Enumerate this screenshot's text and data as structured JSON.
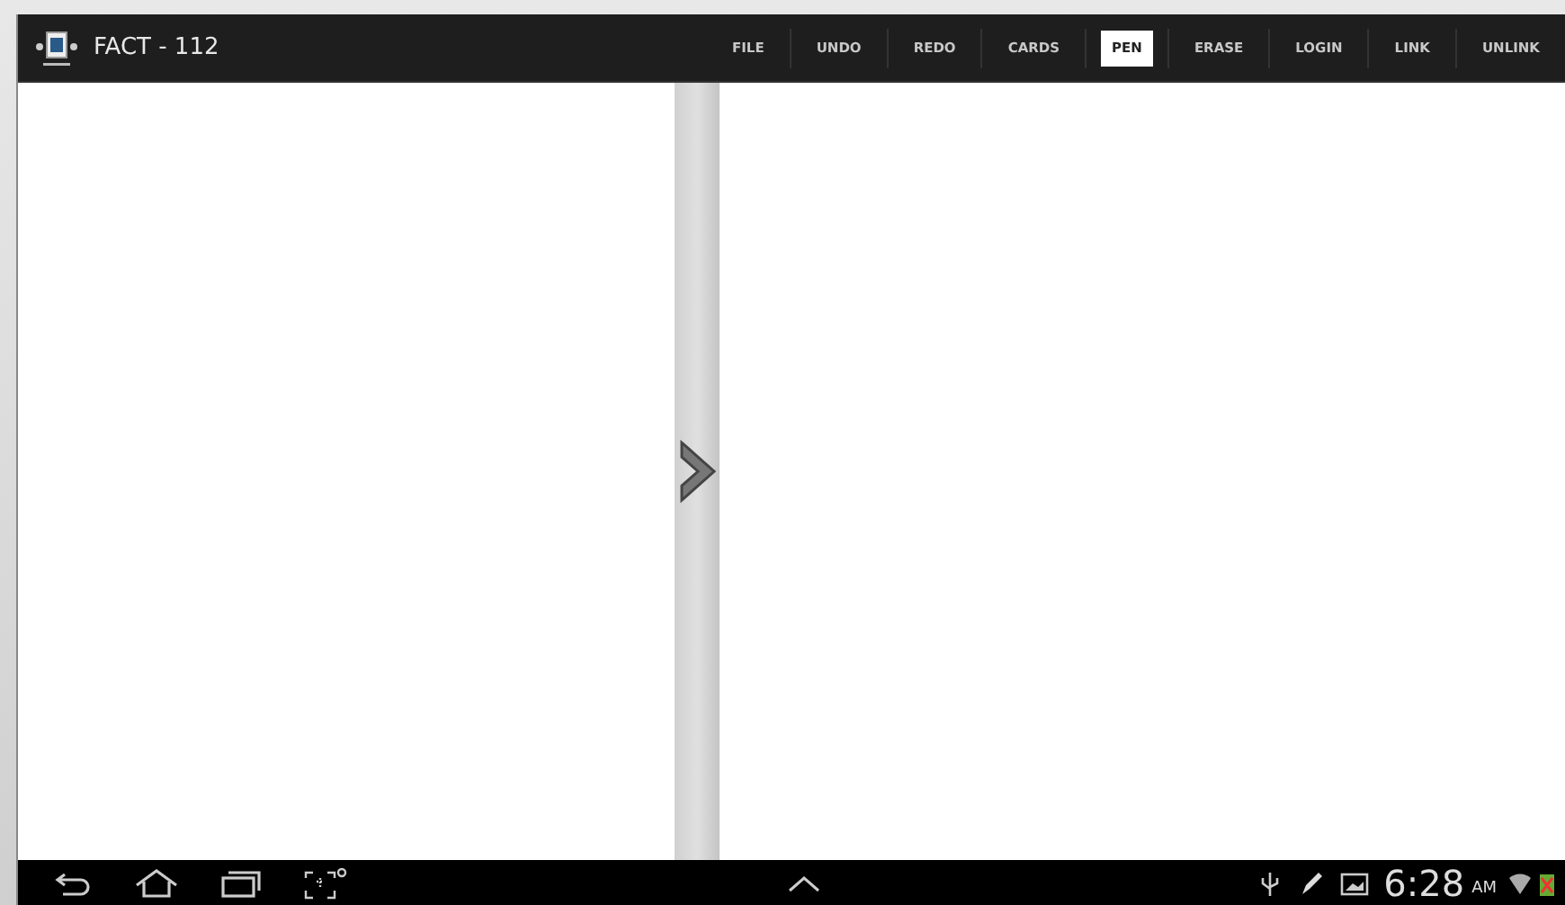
{
  "action_bar": {
    "title": "FACT - 112",
    "actions": [
      {
        "label": "FILE",
        "selected": false
      },
      {
        "label": "UNDO",
        "selected": false
      },
      {
        "label": "REDO",
        "selected": false
      },
      {
        "label": "CARDS",
        "selected": false
      },
      {
        "label": "PEN",
        "selected": true
      },
      {
        "label": "ERASE",
        "selected": false
      },
      {
        "label": "LOGIN",
        "selected": false
      },
      {
        "label": "LINK",
        "selected": false
      },
      {
        "label": "UNLINK",
        "selected": false
      }
    ]
  },
  "system_bar": {
    "time": "6:28",
    "meridiem": "AM"
  }
}
